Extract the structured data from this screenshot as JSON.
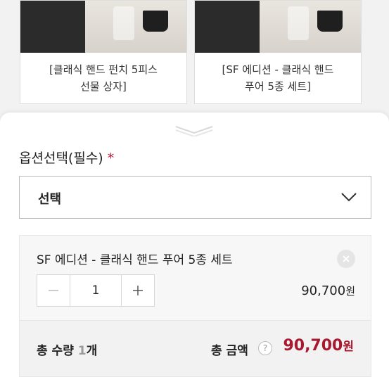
{
  "cards": [
    {
      "title_line1": "[클래식 핸드 펀치 5피스",
      "title_line2": "선물 상자]"
    },
    {
      "title_line1": "[SF 에디션 - 클래식 핸드",
      "title_line2": "푸어 5종 세트]"
    }
  ],
  "option": {
    "label": "옵션선택(필수)",
    "required_mark": "*",
    "select_value": "선택"
  },
  "selected_item": {
    "name": "SF 에디션 - 클래식 핸드 푸어 5종 세트",
    "quantity": "1",
    "price": "90,700",
    "currency": "원"
  },
  "summary": {
    "qty_prefix": "총 수량 ",
    "qty_value": "1",
    "qty_unit": "개",
    "amount_label": "총 금액",
    "help_glyph": "?",
    "total": "90,700",
    "currency": "원"
  },
  "colors": {
    "accent": "#a8182f",
    "required": "#c01d3b"
  },
  "icons": [
    "chevron-down-icon",
    "minus-icon",
    "plus-icon",
    "close-icon",
    "help-icon",
    "drag-handle-icon"
  ]
}
